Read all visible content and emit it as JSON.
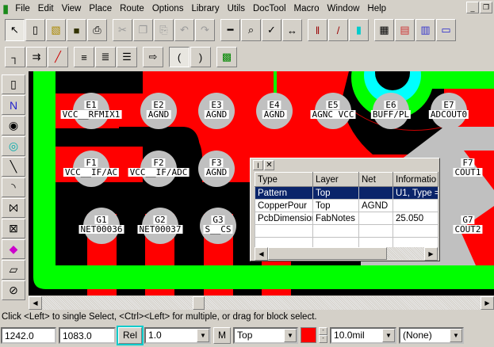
{
  "menu": [
    "File",
    "Edit",
    "View",
    "Place",
    "Route",
    "Options",
    "Library",
    "Utils",
    "DocTool",
    "Macro",
    "Window",
    "Help"
  ],
  "toolbar1": [
    "select-icon",
    "new-icon",
    "open-icon",
    "save-icon",
    "print-icon",
    "cut-icon",
    "copy-icon",
    "paste-icon",
    "undo-icon",
    "redo-icon",
    "measure-icon",
    "zoom-icon",
    "drc-icon",
    "netlist-icon",
    "layer-icon",
    "route-icon",
    "layer-color-icon",
    "spreadsheet-icon",
    "pattern-icon",
    "component-icon",
    "pad-icon"
  ],
  "toolbar2": [
    "route-manual-icon",
    "route-interactive-icon",
    "route-miter-icon",
    "route-bus-icon",
    "route-multi-icon",
    "route-fanout-icon",
    "pushpin-icon",
    "arc-route-a-icon",
    "arc-route-b-icon",
    "copper-pour-icon"
  ],
  "lefttools": [
    "place-component-icon",
    "place-connection-icon",
    "place-pad-icon",
    "place-via-icon",
    "place-line-icon",
    "place-arc-icon",
    "place-polygon-icon",
    "place-cutout-icon",
    "place-fill-icon",
    "place-plane-icon",
    "keepout-icon"
  ],
  "pads": [
    {
      "id": "E1",
      "net": "VCC__RFMIX1"
    },
    {
      "id": "E2",
      "net": "AGND"
    },
    {
      "id": "E3",
      "net": "AGND"
    },
    {
      "id": "E4",
      "net": "AGND"
    },
    {
      "id": "E5",
      "net": "AGNC VCC"
    },
    {
      "id": "E6",
      "net": "BUFF/PL"
    },
    {
      "id": "E7",
      "net": "ADCOUT0"
    },
    {
      "id": "F1",
      "net": "VCC__IF/AC"
    },
    {
      "id": "F2",
      "net": "VCC__IF/ADC"
    },
    {
      "id": "F3",
      "net": "AGND"
    },
    {
      "id": "F7",
      "net": "COUT1"
    },
    {
      "id": "G1",
      "net": "NET00036"
    },
    {
      "id": "G2",
      "net": "NET00037"
    },
    {
      "id": "G3",
      "net": "S__CS"
    },
    {
      "id": "G7",
      "net": "COUT2"
    }
  ],
  "popup": {
    "headers": [
      "Type",
      "Layer",
      "Net",
      "Informatio"
    ],
    "rows": [
      [
        "Pattern",
        "Top",
        "",
        "U1, Type ="
      ],
      [
        "CopperPour",
        "Top",
        "AGND",
        ""
      ],
      [
        "PcbDimension",
        "FabNotes",
        "",
        "25.050"
      ],
      [
        "",
        "",
        "",
        ""
      ],
      [
        "",
        "",
        "",
        ""
      ]
    ]
  },
  "status": "Click <Left> to single Select, <Ctrl><Left> for multiple, or drag for block select.",
  "bottom": {
    "x": "1242.0",
    "y": "1083.0",
    "rel": "Rel",
    "grid": "1.0",
    "m": "M",
    "layer": "Top",
    "width": "10.0mil",
    "style": "(None)"
  },
  "colors": {
    "top_layer": "#ff0000",
    "board": "#00ff00",
    "pad": "#c0c0c0",
    "selection": "#0a246a"
  }
}
